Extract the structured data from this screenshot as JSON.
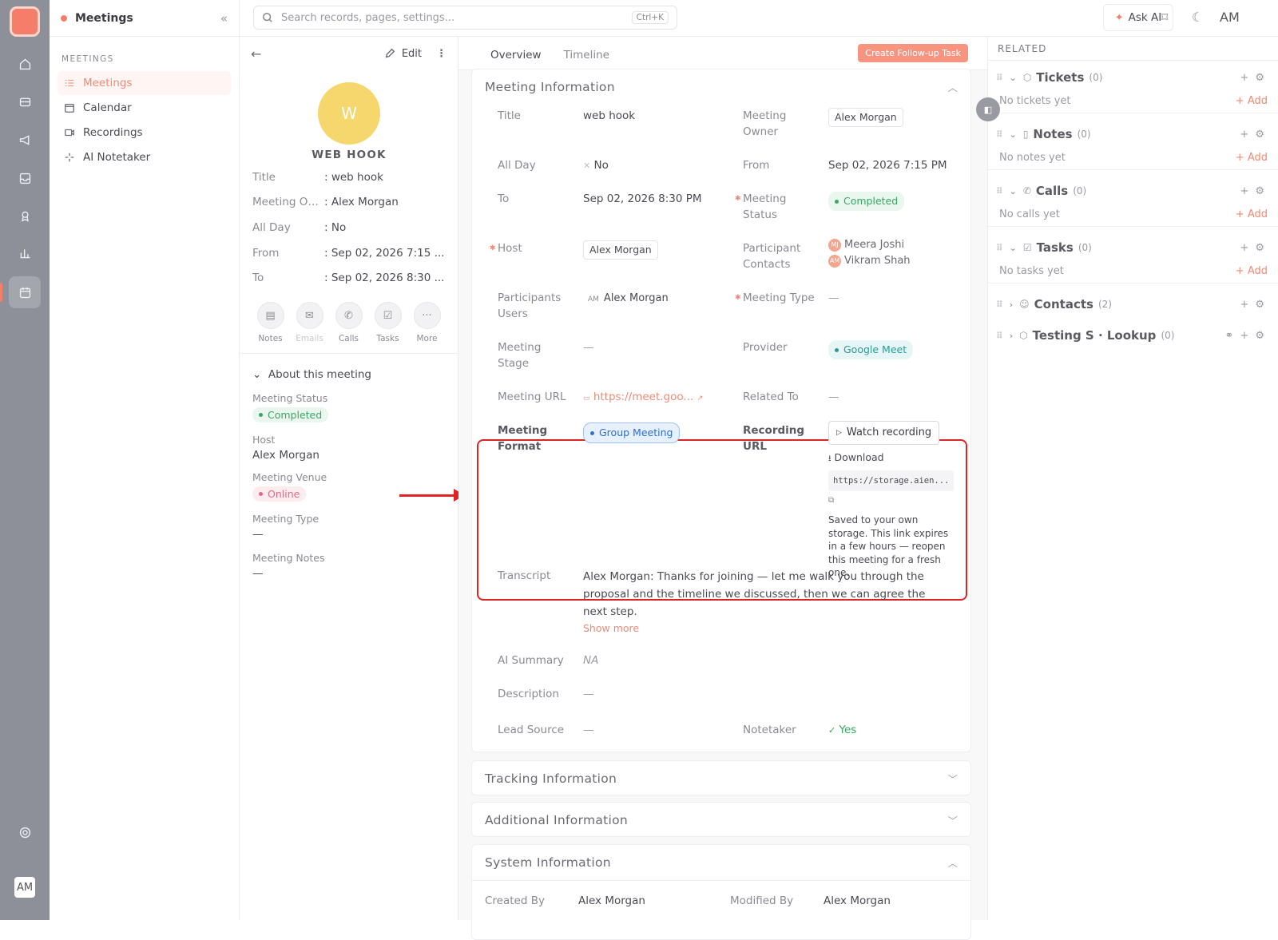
{
  "header": {
    "module_title": "Meetings",
    "search_placeholder": "Search records, pages, settings...",
    "search_shortcut": "Ctrl+K",
    "ask_ai": "Ask AI",
    "user_initials": "AM"
  },
  "nav": {
    "section": "MEETINGS",
    "items": [
      {
        "label": "Meetings",
        "icon": "list-icon"
      },
      {
        "label": "Calendar",
        "icon": "calendar-icon"
      },
      {
        "label": "Recordings",
        "icon": "video-icon"
      },
      {
        "label": "AI Notetaker",
        "icon": "sparkle-icon"
      }
    ]
  },
  "detail": {
    "edit_label": "Edit",
    "avatar_letter": "W",
    "record_name": "WEB HOOK",
    "fields": [
      {
        "k": "Title",
        "v": ": web hook"
      },
      {
        "k": "Meeting Ow...",
        "v": ": Alex Morgan"
      },
      {
        "k": "All Day",
        "v": ": No"
      },
      {
        "k": "From",
        "v": ": Sep 02, 2026 7:15 ..."
      },
      {
        "k": "To",
        "v": ": Sep 02, 2026 8:30 ..."
      }
    ],
    "actions": [
      "Notes",
      "Emails",
      "Calls",
      "Tasks",
      "More"
    ],
    "about_title": "About this meeting",
    "about": {
      "status_label": "Meeting Status",
      "status": "Completed",
      "host_label": "Host",
      "host": "Alex Morgan",
      "venue_label": "Meeting Venue",
      "venue": "Online",
      "type_label": "Meeting Type",
      "type": "—",
      "notes_label": "Meeting Notes",
      "notes": "—"
    }
  },
  "main": {
    "tabs": [
      "Overview",
      "Timeline"
    ],
    "cta": "Create Follow-up Task",
    "info_title": "Meeting Information",
    "labels": {
      "title": "Title",
      "owner": "Meeting Owner",
      "allday": "All Day",
      "from": "From",
      "to": "To",
      "status": "Meeting Status",
      "host": "Host",
      "pcontacts": "Participant Contacts",
      "pusers": "Participants Users",
      "mtype": "Meeting Type",
      "stage": "Meeting Stage",
      "provider": "Provider",
      "url": "Meeting URL",
      "related": "Related To",
      "format": "Meeting Format",
      "recurl": "Recording URL",
      "transcript": "Transcript",
      "summary": "AI Summary",
      "description": "Description",
      "lead": "Lead Source",
      "notetaker": "Notetaker"
    },
    "values": {
      "title": "web hook",
      "owner": "Alex Morgan",
      "allday": "No",
      "from": "Sep 02, 2026 7:15 PM",
      "to": "Sep 02, 2026 8:30 PM",
      "status": "Completed",
      "host": "Alex Morgan",
      "contact1_initials": "MJ",
      "contact1": "Meera Joshi",
      "contact2_initials": "AM",
      "contact2": "Vikram Shah",
      "puser_initials": "AM",
      "puser": "Alex Morgan",
      "mtype": "—",
      "stage": "—",
      "provider": "Google Meet",
      "url": "https://meet.goo...",
      "related": "—",
      "format": "Group Meeting",
      "watch": "Watch recording",
      "download": "Download",
      "rec_link": "https://storage.aien...",
      "rec_note": "Saved to your own storage. This link expires in a few hours — reopen this meeting for a fresh one.",
      "transcript": "Alex Morgan: Thanks for joining — let me walk you through the proposal and the timeline we discussed, then we can agree the next step.",
      "show_more": "Show more",
      "summary": "NA",
      "description": "—",
      "lead": "—",
      "notetaker": "Yes"
    },
    "sections": [
      "Tracking Information",
      "Additional Information",
      "System Information"
    ],
    "system": {
      "created_label": "Created By",
      "created": "Alex Morgan",
      "modified_label": "Modified By",
      "modified": "Alex Morgan"
    }
  },
  "related": {
    "title": "RELATED",
    "items": [
      {
        "name": "Tickets",
        "count": "(0)",
        "empty": "No tickets yet"
      },
      {
        "name": "Notes",
        "count": "(0)",
        "empty": "No notes yet"
      },
      {
        "name": "Calls",
        "count": "(0)",
        "empty": "No calls yet"
      },
      {
        "name": "Tasks",
        "count": "(0)",
        "empty": "No tasks yet"
      },
      {
        "name": "Contacts",
        "count": "(2)"
      },
      {
        "name": "Testing S · Lookup",
        "count": "(0)"
      }
    ],
    "add_label": "+ Add"
  },
  "colors": {
    "accent": "#f47e6a",
    "highlight": "#e02323",
    "success": "#3aa662"
  }
}
